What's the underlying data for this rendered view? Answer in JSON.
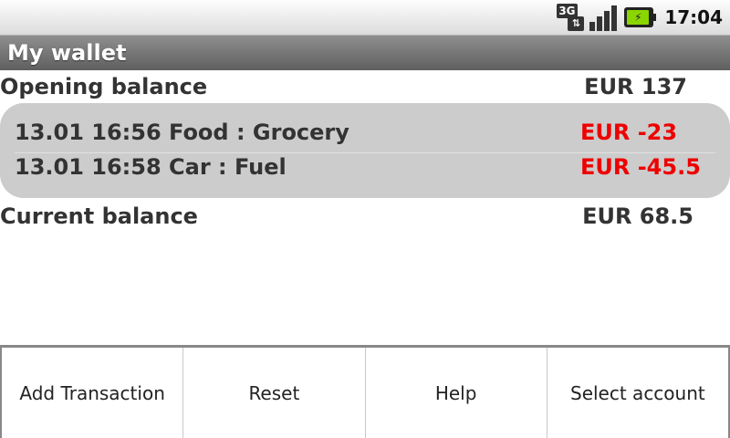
{
  "status_bar": {
    "network_label": "3G",
    "network_arrows": "⇅",
    "battery_glyph": "⚡",
    "time": "17:04",
    "icons": [
      "3g-icon",
      "signal-icon",
      "battery-icon"
    ]
  },
  "header": {
    "title": "My wallet"
  },
  "balances": {
    "opening_label": "Opening balance",
    "opening_amount": "EUR 137",
    "current_label": "Current balance",
    "current_amount": "EUR 68.5"
  },
  "transactions": [
    {
      "description": "13.01 16:56 Food : Grocery",
      "amount": "EUR -23"
    },
    {
      "description": "13.01 16:58 Car : Fuel",
      "amount": "EUR -45.5"
    }
  ],
  "menu": {
    "items": [
      "Add Transaction",
      "Reset",
      "Help",
      "Select account"
    ]
  },
  "colors": {
    "negative_amount": "#ee0000",
    "title_bar": "#6f6f6f",
    "transactions_bg": "#cccccc"
  }
}
